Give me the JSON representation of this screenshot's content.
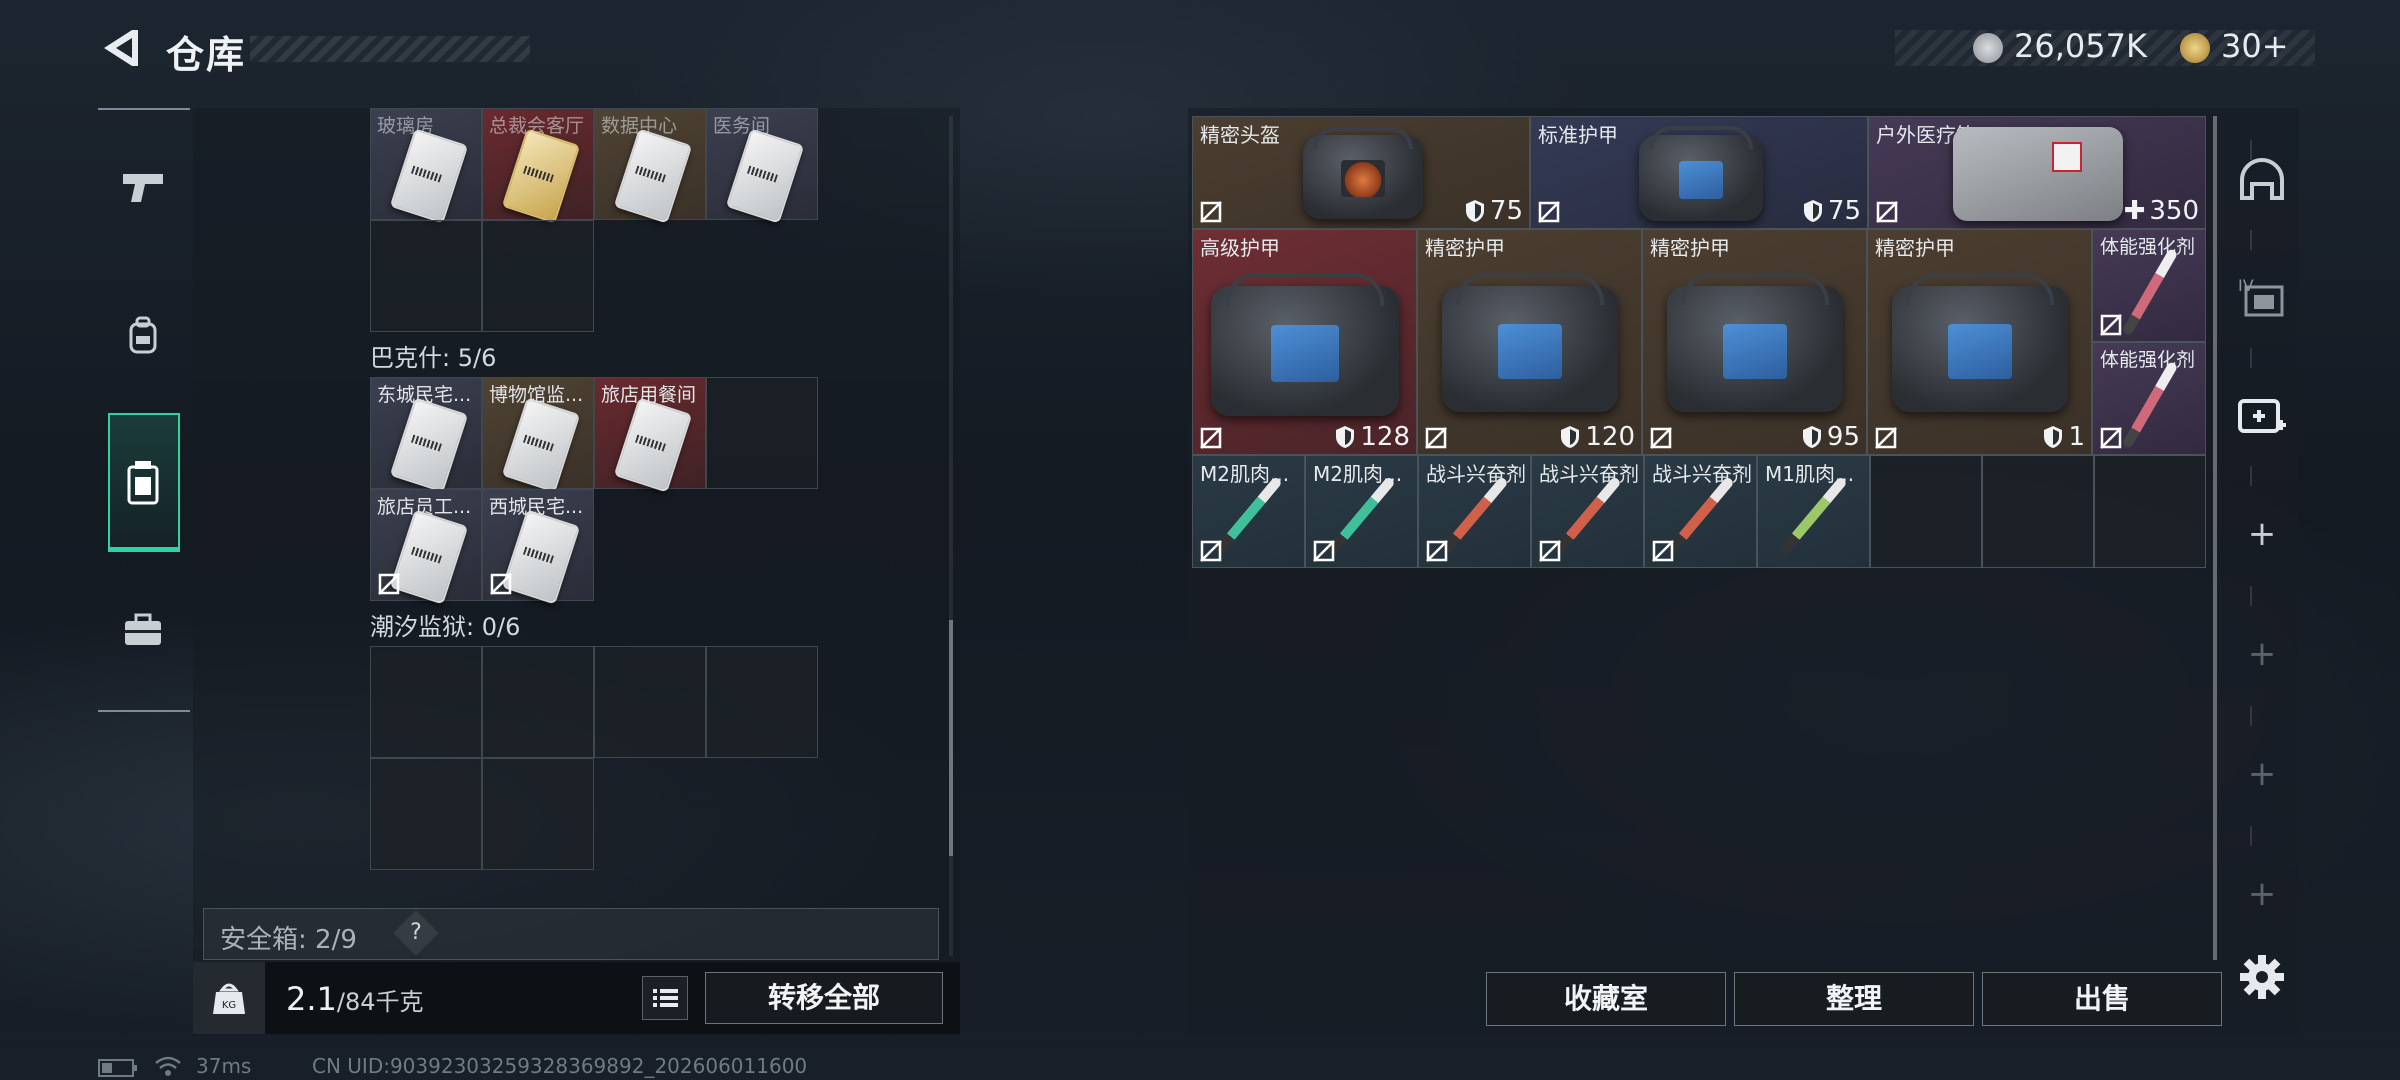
{
  "header": {
    "title": "仓库"
  },
  "currency": {
    "silver": "26,057K",
    "gold": "30+"
  },
  "left_nav": {
    "items": [
      "weapon",
      "backpack",
      "armor",
      "case"
    ]
  },
  "left_panel": {
    "top_row_labels": [
      "玻璃房",
      "总裁会客厅",
      "数据中心",
      "医务间"
    ],
    "section_bakeshi": "巴克什: 5/6",
    "bakeshi_items": [
      "东城民宅...",
      "博物馆监...",
      "旅店用餐间",
      "旅店员工...",
      "西城民宅..."
    ],
    "section_chaoxi": "潮汐监狱: 0/6",
    "safebox_label": "安全箱: 2/9",
    "safebox_help": "?",
    "weight_current": "2.1",
    "weight_max": "/84千克",
    "transfer_all": "转移全部"
  },
  "right_panel": {
    "row1": [
      {
        "label": "精密头盔",
        "value": "75",
        "icon": "shield"
      },
      {
        "label": "标准护甲",
        "value": "75",
        "icon": "shield"
      },
      {
        "label": "户外医疗箱",
        "value": "350",
        "icon": "plus"
      }
    ],
    "row2": [
      {
        "label": "高级护甲",
        "value": "128"
      },
      {
        "label": "精密护甲",
        "value": "120"
      },
      {
        "label": "精密护甲",
        "value": "95"
      },
      {
        "label": "精密护甲",
        "value": "1"
      }
    ],
    "side_items": [
      "体能强化剂",
      "体能强化剂"
    ],
    "row3": [
      "M2肌肉...",
      "M2肌肉...",
      "战斗兴奋剂",
      "战斗兴奋剂",
      "战斗兴奋剂",
      "M1肌肉..."
    ],
    "buttons": {
      "collection": "收藏室",
      "organize": "整理",
      "sell": "出售"
    }
  },
  "status_bar": {
    "ping": "37ms",
    "uid": "CN UID:90392303259328369892_202606011600"
  },
  "colors": {
    "accent": "#2fd3a0",
    "panel": "#181d24"
  }
}
